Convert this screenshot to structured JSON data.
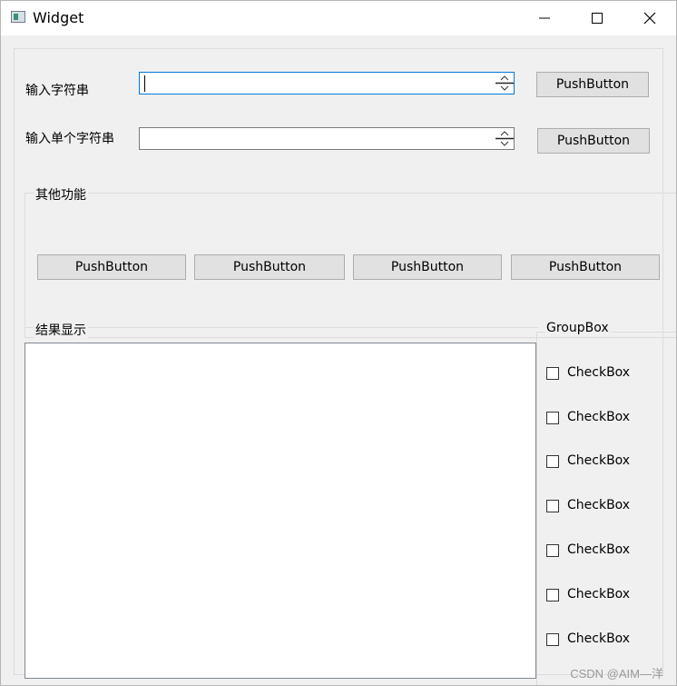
{
  "window": {
    "title": "Widget",
    "icon": "app-window-icon",
    "controls": [
      "minimize-icon",
      "maximize-icon",
      "close-icon"
    ]
  },
  "form": {
    "row1_label": "输入字符串",
    "row1_value": "",
    "row1_button": "PushButton",
    "row2_label": "输入单个字符串",
    "row2_value": "",
    "row2_button": "PushButton"
  },
  "other_group": {
    "title": "其他功能",
    "buttons": [
      "PushButton",
      "PushButton",
      "PushButton",
      "PushButton"
    ]
  },
  "result_group": {
    "title": "结果显示",
    "content": ""
  },
  "checkbox_group": {
    "title": "GroupBox",
    "checkboxes": [
      {
        "label": "CheckBox",
        "checked": false
      },
      {
        "label": "CheckBox",
        "checked": false
      },
      {
        "label": "CheckBox",
        "checked": false
      },
      {
        "label": "CheckBox",
        "checked": false
      },
      {
        "label": "CheckBox",
        "checked": false
      },
      {
        "label": "CheckBox",
        "checked": false
      },
      {
        "label": "CheckBox",
        "checked": false
      }
    ]
  },
  "watermark": "CSDN @AIM—洋"
}
